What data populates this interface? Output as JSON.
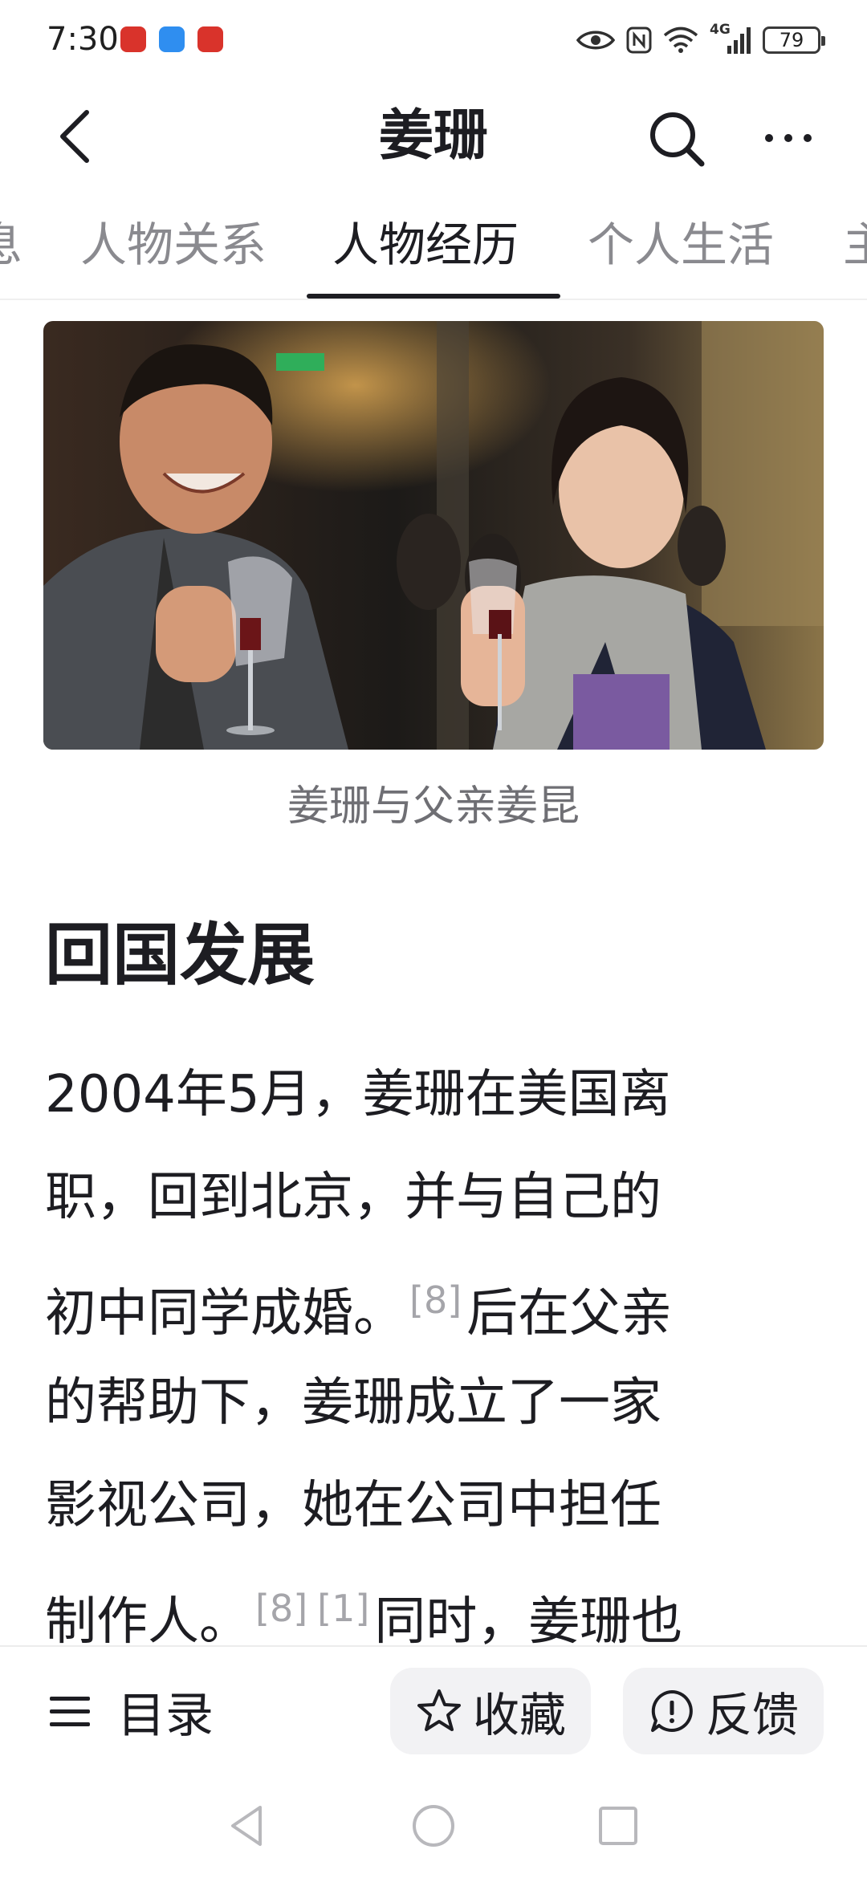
{
  "status_bar": {
    "time": "7:30",
    "app_badges": [
      "huawei-icon",
      "app-icon",
      "huawei-icon"
    ],
    "icons": [
      "eye-icon",
      "nfc-icon",
      "wifi-icon",
      "signal-4g-icon"
    ],
    "network_label": "4G",
    "battery": "79"
  },
  "nav": {
    "title": "姜珊",
    "back_icon": "back-arrow-icon",
    "search_icon": "search-icon",
    "more_icon": "more-icon"
  },
  "tabs": [
    {
      "label": "基本信息",
      "visible_text": "息",
      "active": false
    },
    {
      "label": "人物关系",
      "active": false
    },
    {
      "label": "人物经历",
      "active": true
    },
    {
      "label": "个人生活",
      "active": false
    },
    {
      "label": "主要作品",
      "visible_text": "主",
      "active": false
    }
  ],
  "photo": {
    "caption": "姜珊与父亲姜昆"
  },
  "article": {
    "heading": "回国发展",
    "lines": [
      {
        "text": "2004年5月，姜珊在美国离"
      },
      {
        "text": "职，回到北京，并与自己的"
      },
      {
        "text": "初中同学成婚。",
        "ref1": "[8]",
        "tail": "后在父亲"
      },
      {
        "text": "的帮助下，姜珊成立了一家"
      },
      {
        "text": "影视公司，她在公司中担任"
      },
      {
        "text": "制作人。",
        "ref1": "[8]",
        "ref2": "[1]",
        "tail": "同时，姜珊也"
      }
    ]
  },
  "bottom_bar": {
    "toc_label": "目录",
    "favorite_label": "收藏",
    "feedback_label": "反馈"
  },
  "colors": {
    "text_primary": "#1d1d22",
    "text_secondary": "#8a8a8f",
    "ref_color": "#a5a5aa",
    "pill_bg": "#f2f2f4"
  }
}
